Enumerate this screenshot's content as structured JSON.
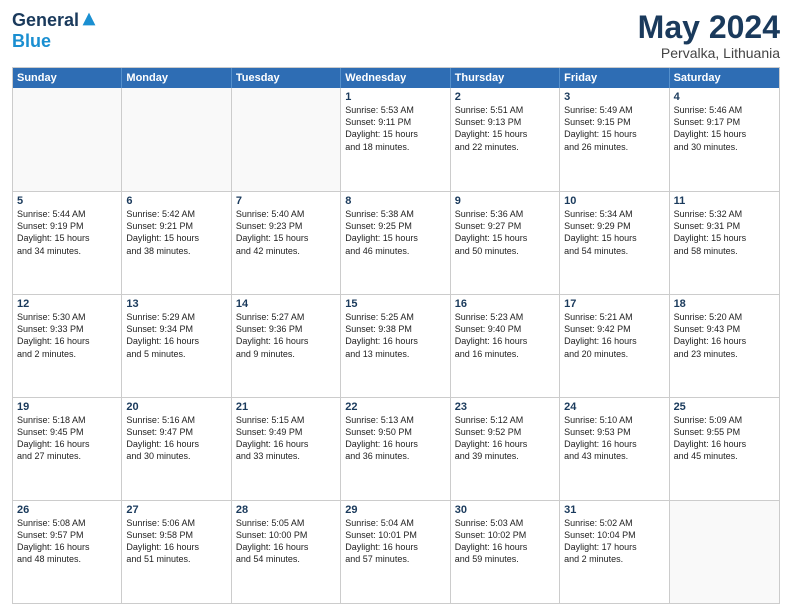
{
  "header": {
    "logo": {
      "general": "General",
      "blue": "Blue"
    },
    "title": "May 2024",
    "location": "Pervalka, Lithuania"
  },
  "calendar": {
    "days_of_week": [
      "Sunday",
      "Monday",
      "Tuesday",
      "Wednesday",
      "Thursday",
      "Friday",
      "Saturday"
    ],
    "weeks": [
      [
        {
          "day": "",
          "empty": true
        },
        {
          "day": "",
          "empty": true
        },
        {
          "day": "",
          "empty": true
        },
        {
          "day": "1",
          "lines": [
            "Sunrise: 5:53 AM",
            "Sunset: 9:11 PM",
            "Daylight: 15 hours",
            "and 18 minutes."
          ]
        },
        {
          "day": "2",
          "lines": [
            "Sunrise: 5:51 AM",
            "Sunset: 9:13 PM",
            "Daylight: 15 hours",
            "and 22 minutes."
          ]
        },
        {
          "day": "3",
          "lines": [
            "Sunrise: 5:49 AM",
            "Sunset: 9:15 PM",
            "Daylight: 15 hours",
            "and 26 minutes."
          ]
        },
        {
          "day": "4",
          "lines": [
            "Sunrise: 5:46 AM",
            "Sunset: 9:17 PM",
            "Daylight: 15 hours",
            "and 30 minutes."
          ]
        }
      ],
      [
        {
          "day": "5",
          "lines": [
            "Sunrise: 5:44 AM",
            "Sunset: 9:19 PM",
            "Daylight: 15 hours",
            "and 34 minutes."
          ]
        },
        {
          "day": "6",
          "lines": [
            "Sunrise: 5:42 AM",
            "Sunset: 9:21 PM",
            "Daylight: 15 hours",
            "and 38 minutes."
          ]
        },
        {
          "day": "7",
          "lines": [
            "Sunrise: 5:40 AM",
            "Sunset: 9:23 PM",
            "Daylight: 15 hours",
            "and 42 minutes."
          ]
        },
        {
          "day": "8",
          "lines": [
            "Sunrise: 5:38 AM",
            "Sunset: 9:25 PM",
            "Daylight: 15 hours",
            "and 46 minutes."
          ]
        },
        {
          "day": "9",
          "lines": [
            "Sunrise: 5:36 AM",
            "Sunset: 9:27 PM",
            "Daylight: 15 hours",
            "and 50 minutes."
          ]
        },
        {
          "day": "10",
          "lines": [
            "Sunrise: 5:34 AM",
            "Sunset: 9:29 PM",
            "Daylight: 15 hours",
            "and 54 minutes."
          ]
        },
        {
          "day": "11",
          "lines": [
            "Sunrise: 5:32 AM",
            "Sunset: 9:31 PM",
            "Daylight: 15 hours",
            "and 58 minutes."
          ]
        }
      ],
      [
        {
          "day": "12",
          "lines": [
            "Sunrise: 5:30 AM",
            "Sunset: 9:33 PM",
            "Daylight: 16 hours",
            "and 2 minutes."
          ]
        },
        {
          "day": "13",
          "lines": [
            "Sunrise: 5:29 AM",
            "Sunset: 9:34 PM",
            "Daylight: 16 hours",
            "and 5 minutes."
          ]
        },
        {
          "day": "14",
          "lines": [
            "Sunrise: 5:27 AM",
            "Sunset: 9:36 PM",
            "Daylight: 16 hours",
            "and 9 minutes."
          ]
        },
        {
          "day": "15",
          "lines": [
            "Sunrise: 5:25 AM",
            "Sunset: 9:38 PM",
            "Daylight: 16 hours",
            "and 13 minutes."
          ]
        },
        {
          "day": "16",
          "lines": [
            "Sunrise: 5:23 AM",
            "Sunset: 9:40 PM",
            "Daylight: 16 hours",
            "and 16 minutes."
          ]
        },
        {
          "day": "17",
          "lines": [
            "Sunrise: 5:21 AM",
            "Sunset: 9:42 PM",
            "Daylight: 16 hours",
            "and 20 minutes."
          ]
        },
        {
          "day": "18",
          "lines": [
            "Sunrise: 5:20 AM",
            "Sunset: 9:43 PM",
            "Daylight: 16 hours",
            "and 23 minutes."
          ]
        }
      ],
      [
        {
          "day": "19",
          "lines": [
            "Sunrise: 5:18 AM",
            "Sunset: 9:45 PM",
            "Daylight: 16 hours",
            "and 27 minutes."
          ]
        },
        {
          "day": "20",
          "lines": [
            "Sunrise: 5:16 AM",
            "Sunset: 9:47 PM",
            "Daylight: 16 hours",
            "and 30 minutes."
          ]
        },
        {
          "day": "21",
          "lines": [
            "Sunrise: 5:15 AM",
            "Sunset: 9:49 PM",
            "Daylight: 16 hours",
            "and 33 minutes."
          ]
        },
        {
          "day": "22",
          "lines": [
            "Sunrise: 5:13 AM",
            "Sunset: 9:50 PM",
            "Daylight: 16 hours",
            "and 36 minutes."
          ]
        },
        {
          "day": "23",
          "lines": [
            "Sunrise: 5:12 AM",
            "Sunset: 9:52 PM",
            "Daylight: 16 hours",
            "and 39 minutes."
          ]
        },
        {
          "day": "24",
          "lines": [
            "Sunrise: 5:10 AM",
            "Sunset: 9:53 PM",
            "Daylight: 16 hours",
            "and 43 minutes."
          ]
        },
        {
          "day": "25",
          "lines": [
            "Sunrise: 5:09 AM",
            "Sunset: 9:55 PM",
            "Daylight: 16 hours",
            "and 45 minutes."
          ]
        }
      ],
      [
        {
          "day": "26",
          "lines": [
            "Sunrise: 5:08 AM",
            "Sunset: 9:57 PM",
            "Daylight: 16 hours",
            "and 48 minutes."
          ]
        },
        {
          "day": "27",
          "lines": [
            "Sunrise: 5:06 AM",
            "Sunset: 9:58 PM",
            "Daylight: 16 hours",
            "and 51 minutes."
          ]
        },
        {
          "day": "28",
          "lines": [
            "Sunrise: 5:05 AM",
            "Sunset: 10:00 PM",
            "Daylight: 16 hours",
            "and 54 minutes."
          ]
        },
        {
          "day": "29",
          "lines": [
            "Sunrise: 5:04 AM",
            "Sunset: 10:01 PM",
            "Daylight: 16 hours",
            "and 57 minutes."
          ]
        },
        {
          "day": "30",
          "lines": [
            "Sunrise: 5:03 AM",
            "Sunset: 10:02 PM",
            "Daylight: 16 hours",
            "and 59 minutes."
          ]
        },
        {
          "day": "31",
          "lines": [
            "Sunrise: 5:02 AM",
            "Sunset: 10:04 PM",
            "Daylight: 17 hours",
            "and 2 minutes."
          ]
        },
        {
          "day": "",
          "empty": true
        }
      ]
    ]
  }
}
